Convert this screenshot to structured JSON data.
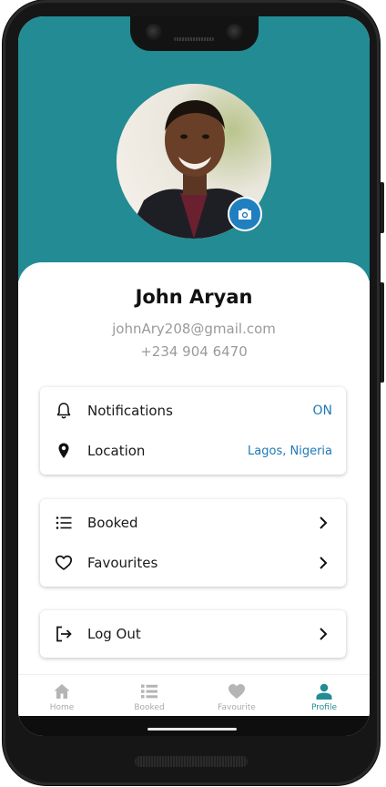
{
  "profile": {
    "name": "John Aryan",
    "email": "johnAry208@gmail.com",
    "phone": "+234 904 6470"
  },
  "settings": {
    "notifications_label": "Notifications",
    "notifications_value": "ON",
    "location_label": "Location",
    "location_value": "Lagos, Nigeria"
  },
  "lists": {
    "booked_label": "Booked",
    "favourites_label": "Favourites"
  },
  "account": {
    "logout_label": "Log Out"
  },
  "bottom_nav": [
    {
      "label": "Home",
      "icon": "home-icon",
      "active": false
    },
    {
      "label": "Booked",
      "icon": "list-icon",
      "active": false
    },
    {
      "label": "Favourite",
      "icon": "heart-icon",
      "active": false
    },
    {
      "label": "Profile",
      "icon": "person-icon",
      "active": true
    }
  ],
  "colors": {
    "header_teal": "#228b93",
    "accent_blue": "#1f79b6",
    "camera_button": "#1f7fbf"
  }
}
